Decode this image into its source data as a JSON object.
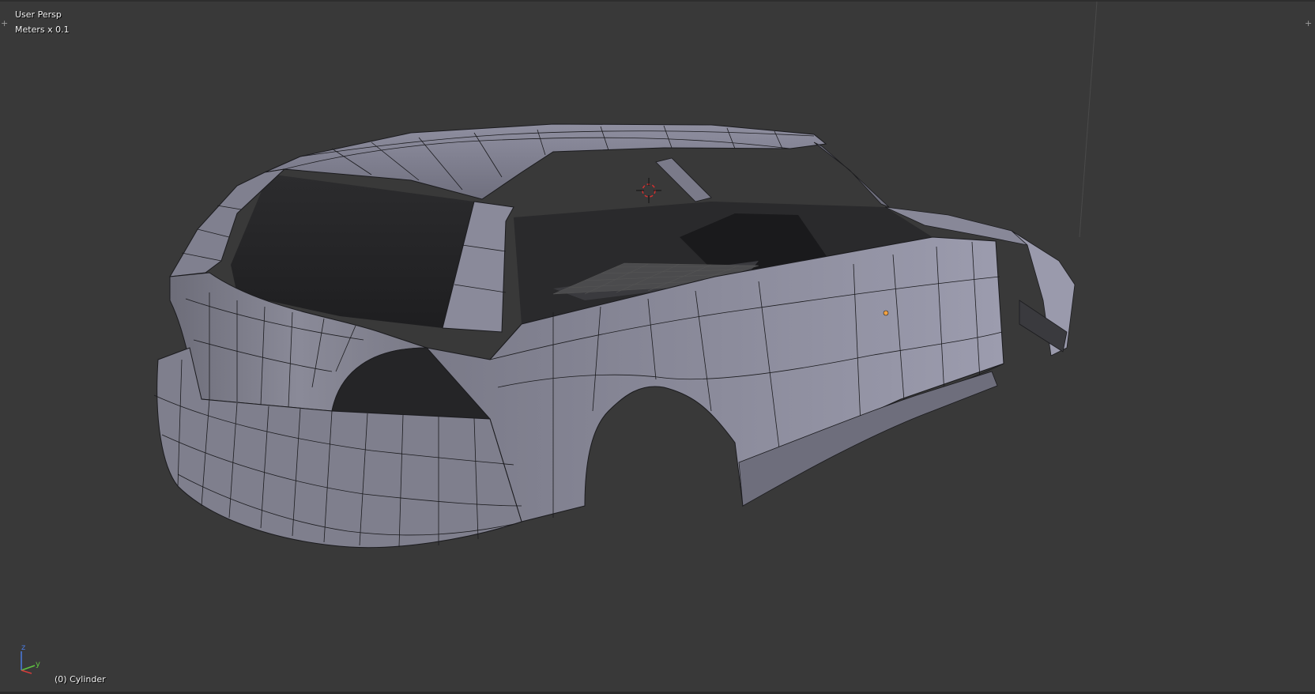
{
  "viewport": {
    "view_name": "User Persp",
    "units": "Meters x 0.1",
    "active_object": "(0) Cylinder"
  },
  "axes": {
    "z_label": "z",
    "y_label": "y"
  },
  "colors": {
    "background": "#393939",
    "mesh_face": "#7d7d8c",
    "mesh_wire": "#1b1b1e",
    "cursor_red": "#d43030",
    "origin_orange": "#f0a040"
  },
  "icons": {
    "cursor": "3d-cursor-icon",
    "origin": "object-origin-icon",
    "axes": "axis-gizmo-icon",
    "corner": "region-resize-icon"
  }
}
